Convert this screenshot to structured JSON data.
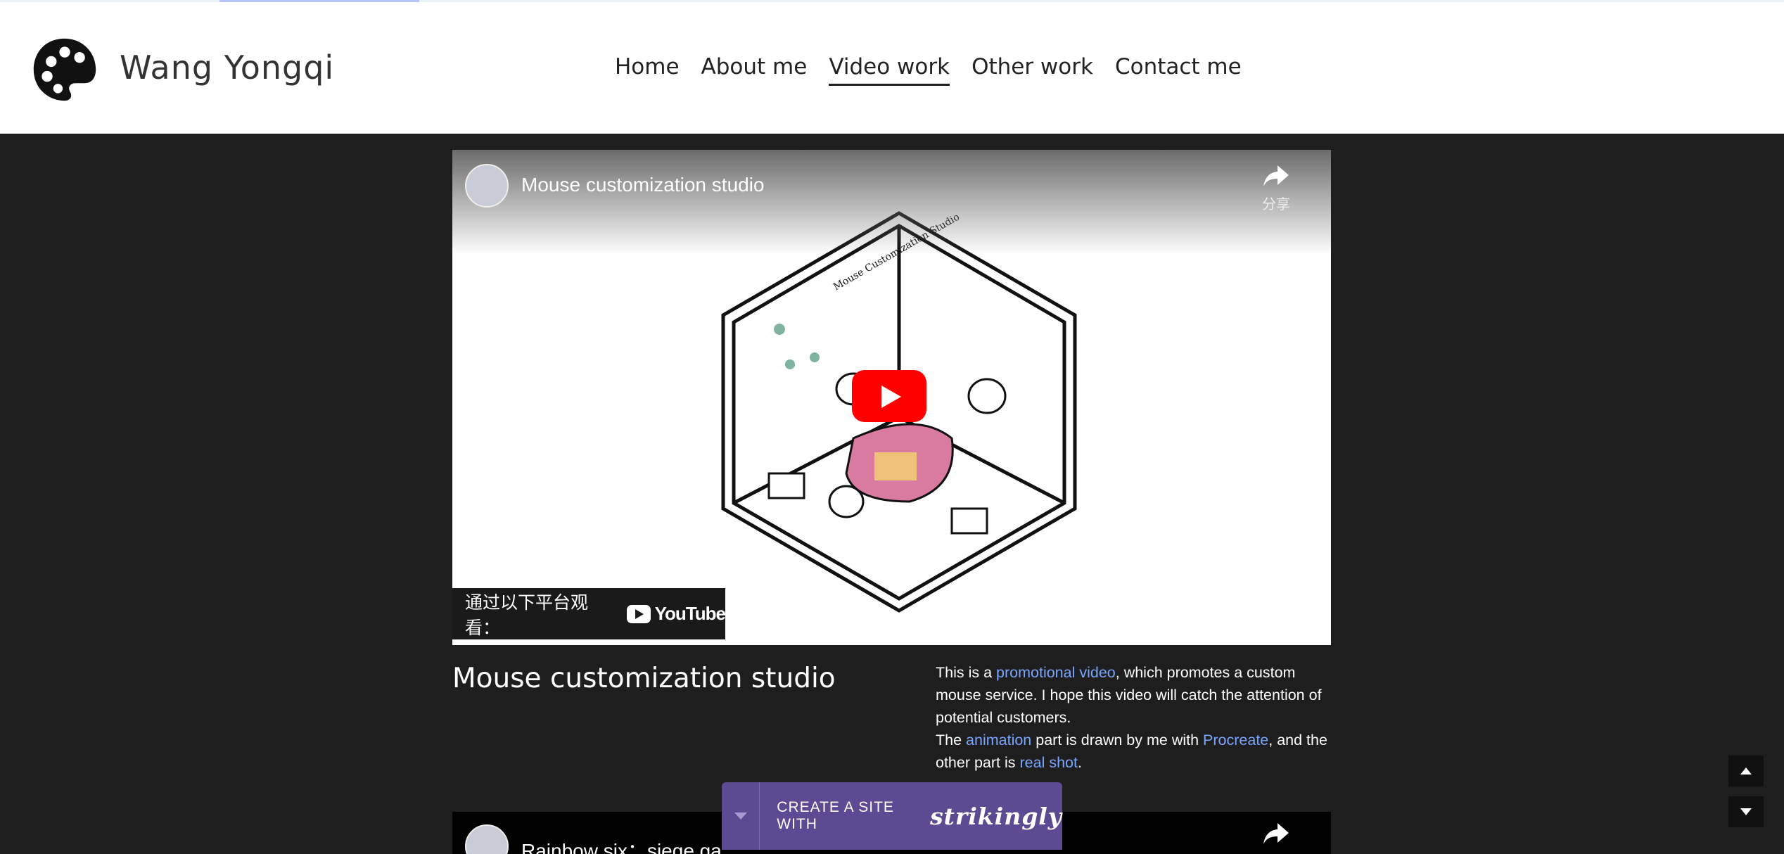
{
  "header": {
    "site_title": "Wang Yongqi",
    "nav": [
      "Home",
      "About me",
      "Video work",
      "Other work",
      "Contact me"
    ],
    "active_nav": "Video work"
  },
  "video1": {
    "title": "Mouse customization studio",
    "share_label": "分享",
    "watch_on": "通过以下平台观看：",
    "youtube": "YouTube",
    "illustration_label": "Mouse Customization Studio"
  },
  "project": {
    "title": "Mouse customization studio",
    "desc": {
      "p1_a": "This is a ",
      "p1_link": "promotional video",
      "p1_b": ", which promotes a custom mouse service. I hope this video will catch the attention of potential customers.",
      "p2_a": "The ",
      "p2_link1": "animation",
      "p2_b": " part is drawn by me with ",
      "p2_link2": "Procreate",
      "p2_c": ", and the other part is ",
      "p2_link3": "real shot",
      "p2_d": "."
    }
  },
  "video2": {
    "title": "Rainbow six：siege ga"
  },
  "banner": {
    "text": "CREATE A SITE WITH",
    "brand": "strikingly"
  },
  "colors": {
    "link": "#7aa5ff",
    "banner": "#5c4a92",
    "page_bg": "#1e1e1e"
  }
}
